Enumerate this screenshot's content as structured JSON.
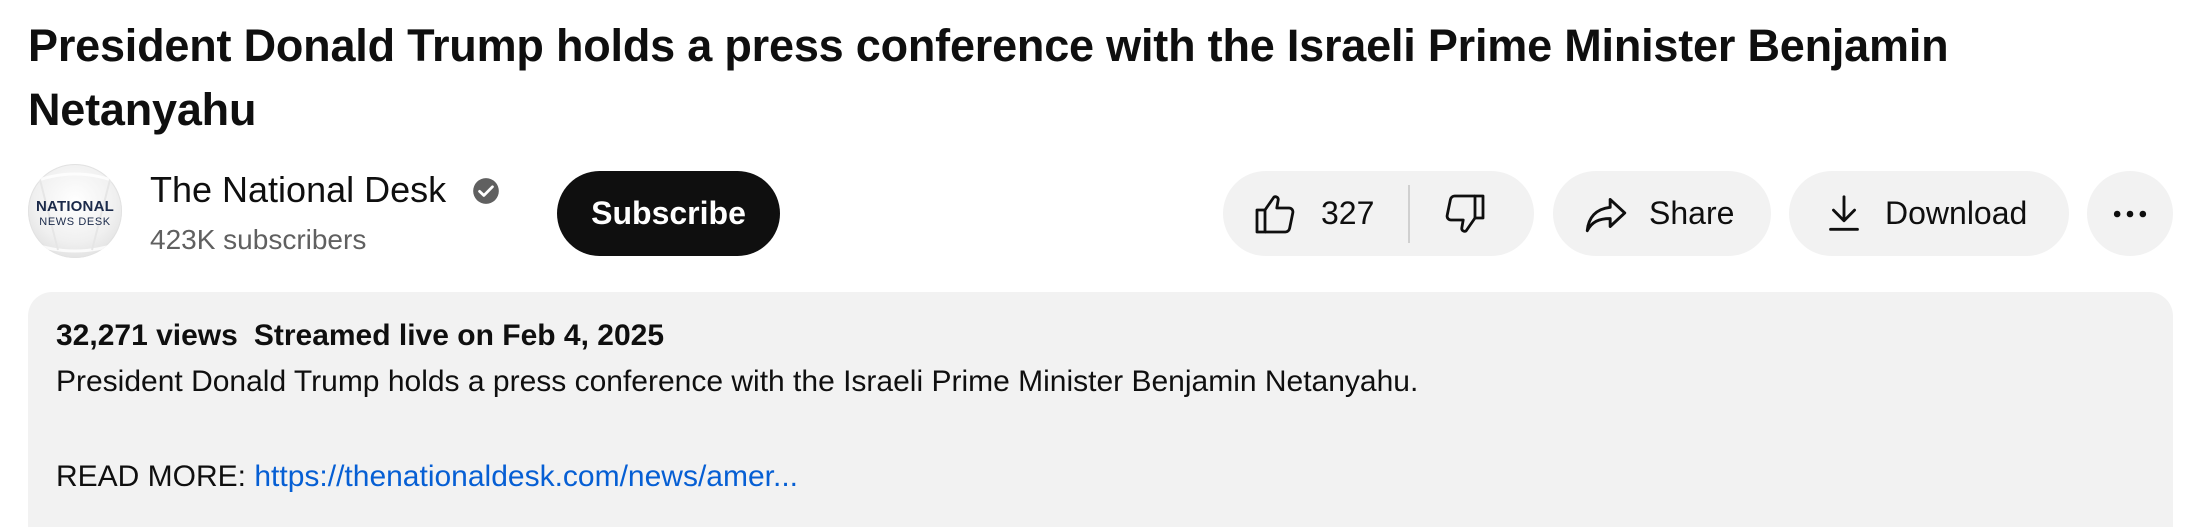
{
  "video": {
    "title": "President Donald Trump holds a press conference with the Israeli Prime Minister Benjamin Netanyahu"
  },
  "channel": {
    "name": "The National Desk",
    "subscribers": "423K subscribers",
    "avatar_text_top": "NATIONAL",
    "avatar_text_bottom": "NEWS DESK",
    "verified": true,
    "subscribe_label": "Subscribe"
  },
  "actions": {
    "like_count": "327",
    "share_label": "Share",
    "download_label": "Download",
    "icons": {
      "like": "thumbs-up-icon",
      "dislike": "thumbs-down-icon",
      "share": "share-arrow-icon",
      "download": "download-icon",
      "more": "more-horizontal-icon",
      "verified": "verified-check-icon"
    }
  },
  "description": {
    "views": "32,271 views",
    "date": "Streamed live on Feb 4, 2025",
    "text": "President Donald Trump holds a press conference with the Israeli Prime Minister Benjamin Netanyahu.",
    "read_more_label": "READ MORE:",
    "read_more_link": "https://thenationaldesk.com/news/amer..."
  },
  "colors": {
    "button_dark": "#0f0f0f",
    "pill_bg": "#f2f2f2",
    "link": "#065fd4",
    "secondary_text": "#606060",
    "avatar_text": "#1b2a4a"
  }
}
